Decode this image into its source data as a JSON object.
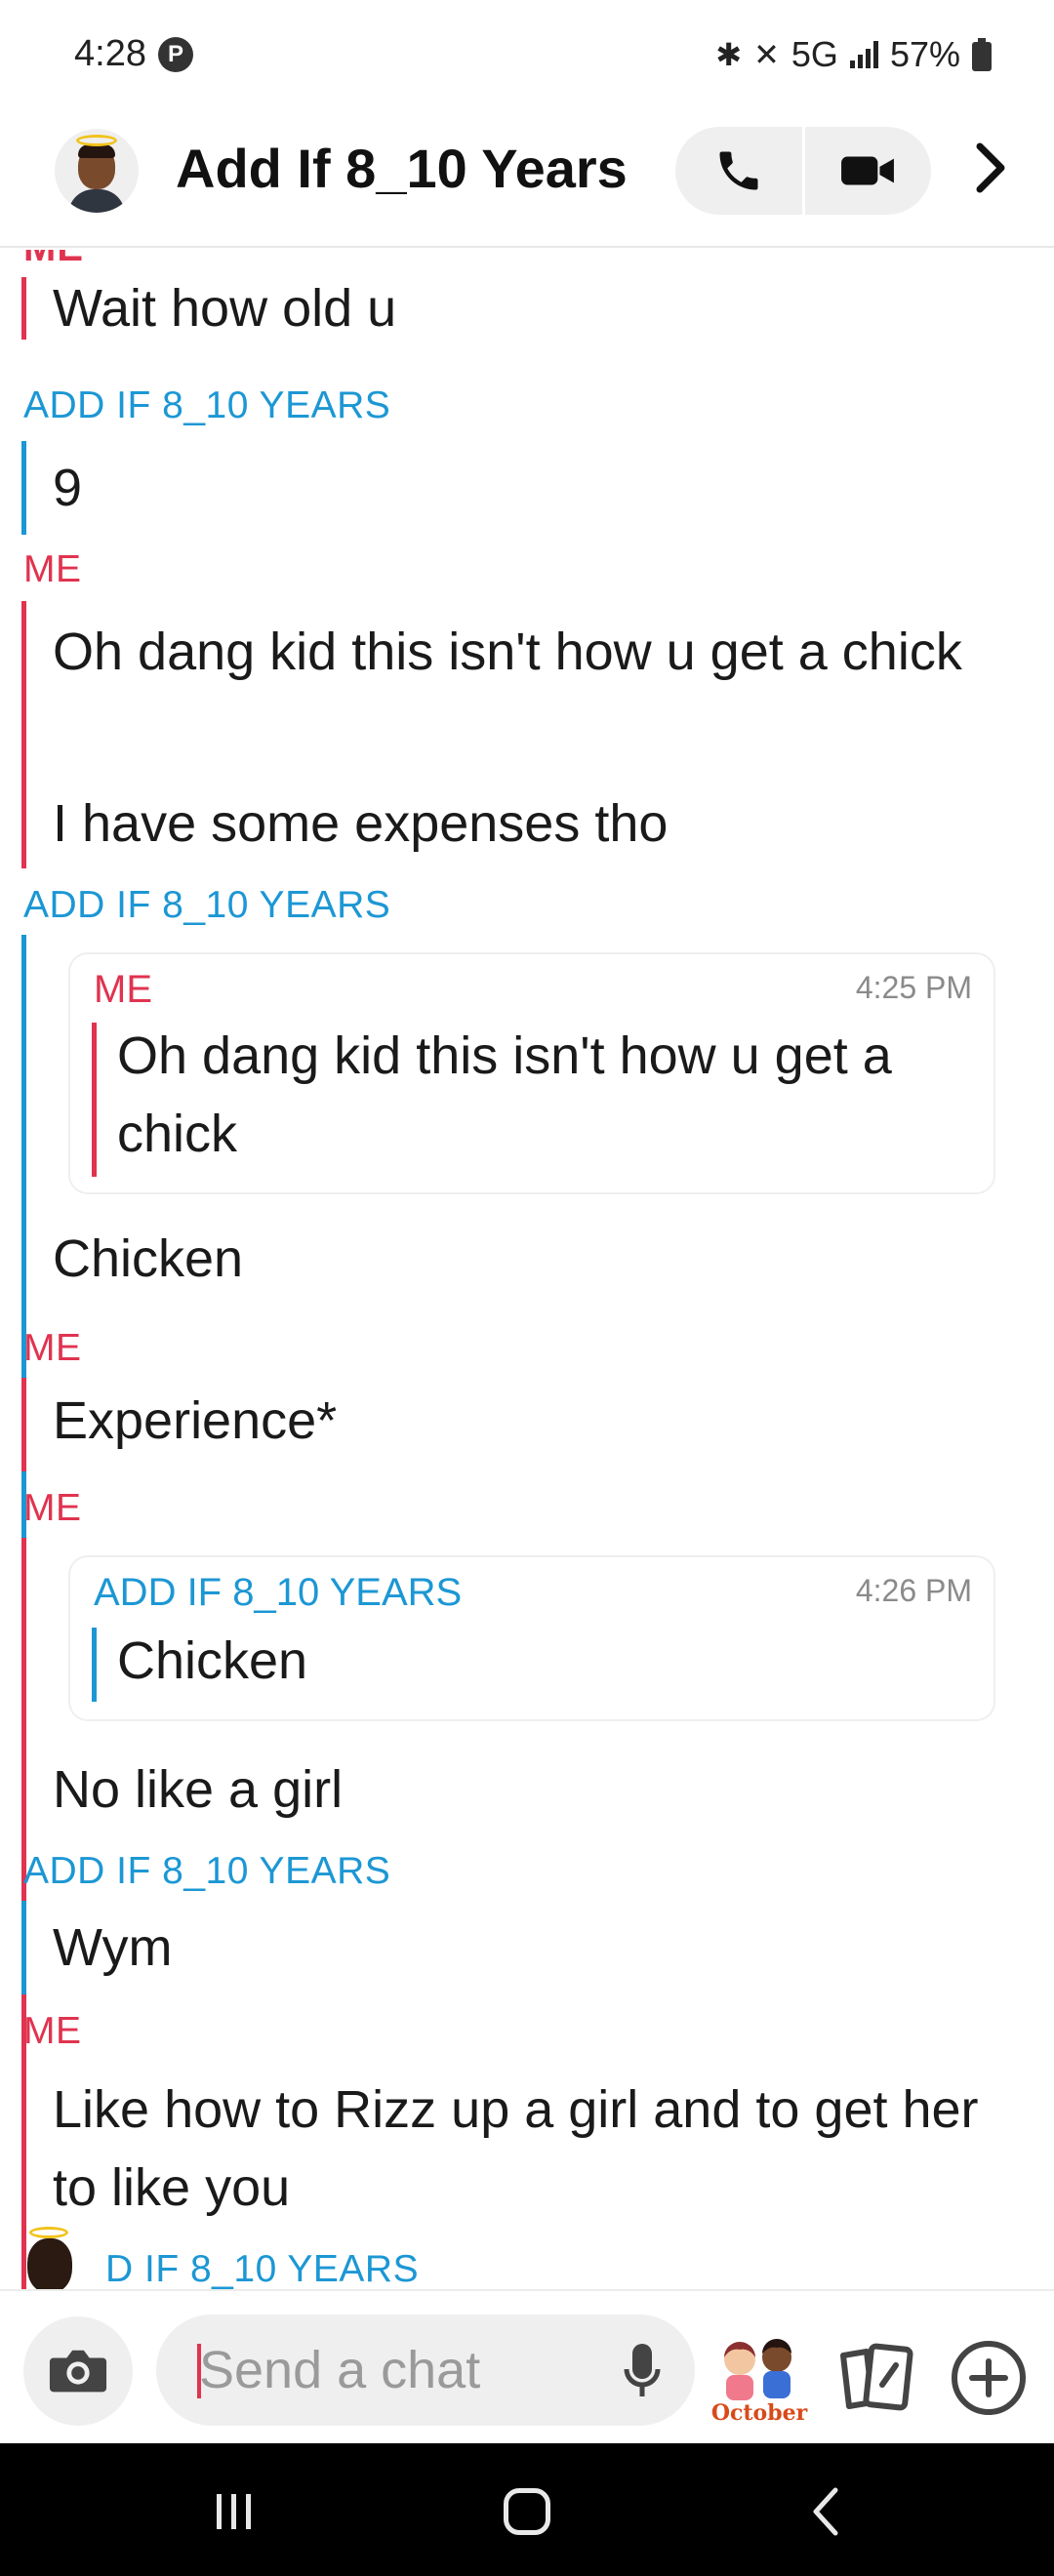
{
  "status_bar": {
    "time": "4:28",
    "network": "5G",
    "battery": "57%"
  },
  "header": {
    "title": "Add If 8_10 Years"
  },
  "chat": {
    "partial_top_label": "ME",
    "groups": [
      {
        "sender": "ME",
        "messages": [
          "Wait how old u"
        ]
      },
      {
        "sender": "ADD IF 8_10 YEARS",
        "messages": [
          "9"
        ]
      },
      {
        "sender": "ME",
        "messages": [
          "Oh dang kid this isn't how u get a chick",
          "I have some expenses tho"
        ]
      },
      {
        "sender": "ADD IF 8_10 YEARS",
        "quote": {
          "sender": "ME",
          "time": "4:25 PM",
          "text": "Oh dang kid this isn't how u get a chick"
        },
        "messages": [
          "Chicken"
        ]
      },
      {
        "sender": "ME",
        "messages": [
          "Experience*"
        ]
      },
      {
        "sender": "ME",
        "quote": {
          "sender": "ADD IF 8_10 YEARS",
          "time": "4:26 PM",
          "text": "Chicken"
        },
        "messages": [
          "No like a girl"
        ]
      },
      {
        "sender": "ADD IF 8_10 YEARS",
        "messages": [
          "Wym"
        ]
      },
      {
        "sender": "ME",
        "messages": [
          "Like how to Rizz up a girl and to get her to like you"
        ]
      },
      {
        "sender": "ADD IF 8_10 YEARS",
        "messages": []
      }
    ],
    "partial_bottom_label": "D IF 8_10 YEARS"
  },
  "input": {
    "placeholder": "Send a chat",
    "sticker_text": "October"
  },
  "colors": {
    "me": "#e0334f",
    "friend": "#1c97d4"
  }
}
